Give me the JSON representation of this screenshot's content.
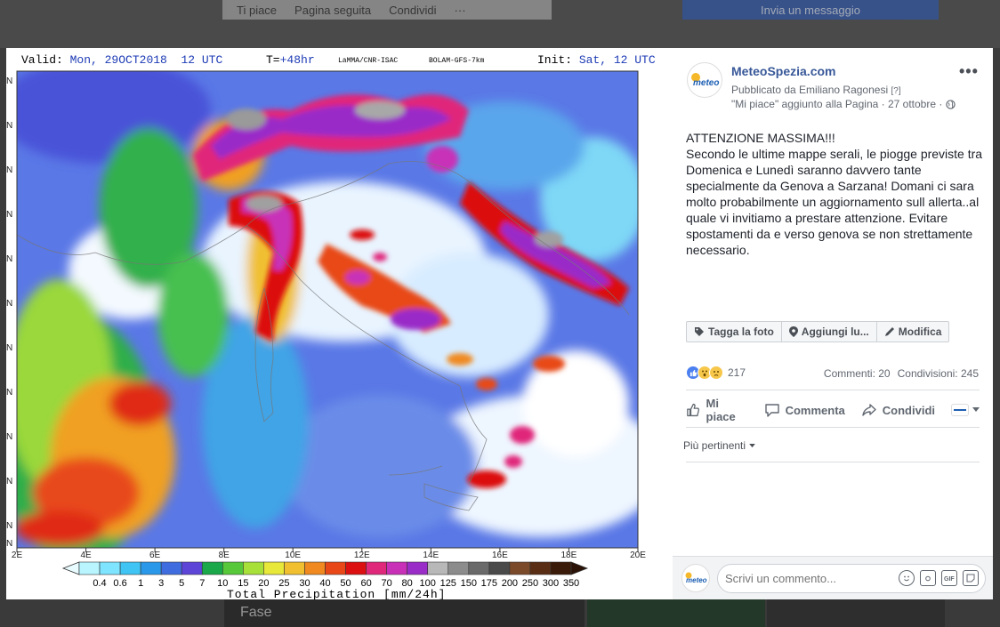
{
  "background": {
    "bar_items": [
      "Ti piace",
      "Pagina seguita",
      "Condividi",
      "···"
    ],
    "message_button": "Invia un messaggio",
    "bottom_label": "Fase"
  },
  "map": {
    "valid_label": "Valid:",
    "valid_value": "Mon, 29OCT2018  12 UTC",
    "t_label": "T=",
    "t_value": "+48hr",
    "source": "LaMMA/CNR-ISAC",
    "model": "BOLAM-GFS-7km",
    "init_label": "Init:",
    "init_value": "Sat, 12 UTC",
    "lat_labels": [
      "N",
      "N",
      "N",
      "N",
      "N",
      "N",
      "N",
      "N",
      "N",
      "N",
      "N",
      "N"
    ],
    "lon_labels": [
      "2E",
      "4E",
      "6E",
      "8E",
      "10E",
      "12E",
      "14E",
      "16E",
      "18E",
      "20E"
    ],
    "colorbar_values": [
      "0.4",
      "0.6",
      "1",
      "3",
      "5",
      "7",
      "10",
      "15",
      "20",
      "25",
      "30",
      "40",
      "50",
      "60",
      "70",
      "80",
      "100",
      "125",
      "150",
      "175",
      "200",
      "250",
      "300",
      "350"
    ],
    "colorbar_colors": [
      "#b8f5ff",
      "#7fe4ff",
      "#3fc4f3",
      "#2a98e8",
      "#3f6de0",
      "#5d45d8",
      "#1aa84a",
      "#56c83a",
      "#a8e03a",
      "#e8e83a",
      "#f0c030",
      "#f08a20",
      "#e84818",
      "#dc1010",
      "#e0287a",
      "#c830b8",
      "#9a2cc8",
      "#b8b8b8",
      "#8c8c8c",
      "#6a6a6a",
      "#4a4a4a",
      "#7a4a2a",
      "#5a2e14",
      "#3a1a08"
    ],
    "colorbar_title": "Total Precipitation [mm/24h]"
  },
  "post": {
    "page_name": "MeteoSpezia.com",
    "published_by": "Pubblicato da Emiliano Ragonesi",
    "help_marker": "[?]",
    "liked_line": "\"Mi piace\" aggiunto alla Pagina · 27 ottobre ·",
    "more": "•••",
    "text_heading": "ATTENZIONE MASSIMA!!!",
    "text_body": "Secondo le ultime mappe serali, le piogge previste tra Domenica e Lunedì saranno davvero tante specialmente da Genova a Sarzana! Domani ci sara molto probabilmente un aggiornamento sull allerta..al quale vi invitiamo a prestare attenzione. Evitare spostamenti da e verso genova se non strettamente necessario.",
    "photo_actions": {
      "tag": "Tagga la foto",
      "location": "Aggiungi lu...",
      "edit": "Modifica"
    },
    "reaction_count": "217",
    "comments": "Commenti: 20",
    "shares": "Condivisioni: 245",
    "actions": {
      "like": "Mi piace",
      "comment": "Commenta",
      "share": "Condividi"
    },
    "more_relevant": "Più pertinenti",
    "comment_placeholder": "Scrivi un commento...",
    "logo_text": "meteo"
  }
}
